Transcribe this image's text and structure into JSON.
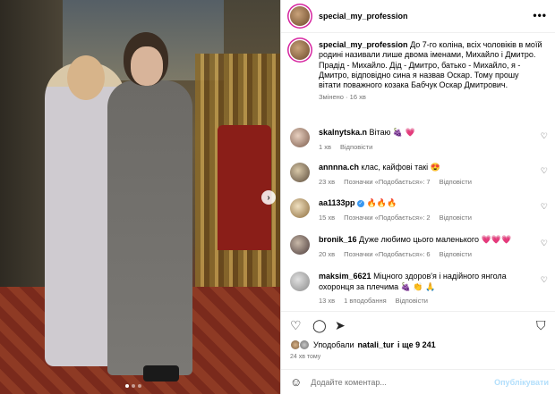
{
  "post": {
    "author": "special_my_profession",
    "more_icon": "more-horizontal-icon",
    "carousel_dots": 3
  },
  "caption": {
    "user": "special_my_profession",
    "text": "До 7-го коліна, всіх чоловіків в моїй родині називали лише двома іменами, Михайло і Дмитро. Прадід - Михайло. Дід - Дмитро, батько - Михайло, я - Дмитро, відповідно сина я назвав Оскар. Тому прошу вітати поважного козака Бабчук Оскар Дмитрович.",
    "meta": "Змінено · 16 хв"
  },
  "comments": [
    {
      "user": "skalnytska.n",
      "text": "Вітаю 🍇 💗",
      "time": "1 хв",
      "reply": "Відповісти",
      "likes": ""
    },
    {
      "user": "annnna.ch",
      "text": "клас, кайфові такі 😍",
      "time": "23 хв",
      "likes": "Позначки «Подобається»: 7",
      "reply": "Відповісти"
    },
    {
      "user": "aa1133pp",
      "text": "🔥🔥🔥",
      "time": "15 хв",
      "likes": "Позначки «Подобається»: 2",
      "reply": "Відповісти",
      "verified": true
    },
    {
      "user": "bronik_16",
      "text": "Дуже любимо цього маленького 💗💗💗",
      "time": "20 хв",
      "likes": "Позначки «Подобається»: 6",
      "reply": "Відповісти"
    },
    {
      "user": "maksim_6621",
      "text": "Міцного здоров'я і надійного янгола охоронця за плечима 🍇 👏 🙏",
      "time": "13 хв",
      "likes": "1 вподобання",
      "reply": "Відповісти"
    }
  ],
  "actions": {
    "like_icon": "heart-icon",
    "comment_icon": "comment-icon",
    "share_icon": "send-icon",
    "save_icon": "bookmark-icon"
  },
  "likes": {
    "prefix": "Уподобали",
    "user": "natali_tur",
    "suffix": "і ще 9 241"
  },
  "timestamp": "24 хв тому",
  "add_comment": {
    "placeholder": "Додайте коментар...",
    "post_label": "Опублікувати",
    "emoji_icon": "smile-icon"
  }
}
